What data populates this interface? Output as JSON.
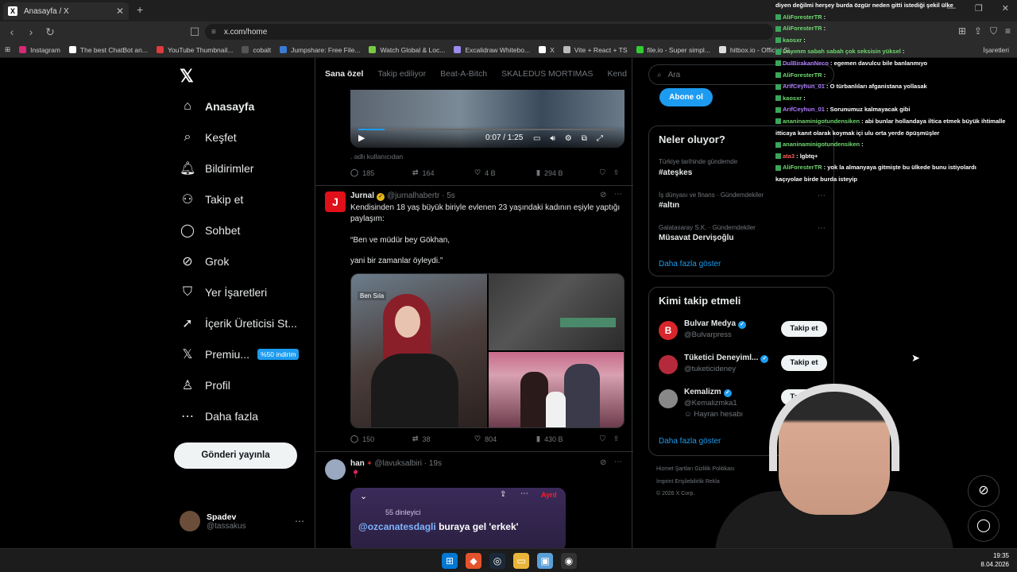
{
  "browser": {
    "tab_title": "Anasayfa / X",
    "url": "x.com/home",
    "bookmarks": [
      "Instagram",
      "The best ChatBot an...",
      "YouTube Thumbnail...",
      "cobalt",
      "Jumpshare: Free File...",
      "Watch Global & Loc...",
      "Excalidraw Whitebo...",
      "X",
      "Vite + React + TS",
      "file.io - Super simpl...",
      "hitbox.io - Official Si..."
    ],
    "bookmarks_more": "İşaretleri"
  },
  "sidebar": {
    "items": [
      {
        "label": "Anasayfa"
      },
      {
        "label": "Keşfet"
      },
      {
        "label": "Bildirimler"
      },
      {
        "label": "Takip et"
      },
      {
        "label": "Sohbet"
      },
      {
        "label": "Grok"
      },
      {
        "label": "Yer İşaretleri"
      },
      {
        "label": "İçerik Üreticisi St..."
      },
      {
        "label": "Premiu..."
      },
      {
        "label": "Profil"
      },
      {
        "label": "Daha fazla"
      }
    ],
    "premium_badge": "%50 indirim",
    "post_button": "Gönderi yayınla",
    "profile_name": "Spadev",
    "profile_handle": "@tassakus"
  },
  "feed": {
    "tabs": [
      "Sana özel",
      "Takip ediliyor",
      "Beat-A-Bitch",
      "SKALEDUS MORTIMAS",
      "Kend"
    ],
    "video": {
      "time": "0:07 / 1:25",
      "progress": 0.1
    },
    "post0": {
      "caption": ". adlı kullanıcıdan",
      "replies": "185",
      "reposts": "164",
      "likes": "4 B",
      "views": "294 B"
    },
    "post1": {
      "name": "Jurnal",
      "handle": "@jurnalhabertr · 5s",
      "text1": "Kendisinden 18 yaş büyük biriyle evlenen 23 yaşındaki kadının eşiyle yaptığı paylaşım:",
      "text2": "“Ben ve müdür bey Gökhan,",
      "text3": "yani bir zamanlar öyleydi.”",
      "image_caption": "Ben Sıla",
      "replies": "150",
      "reposts": "38",
      "likes": "804",
      "views": "430 B"
    },
    "post2": {
      "name": "han",
      "handle": "@lavuksalbiri · 19s",
      "space_listeners": "55 dinleyici",
      "space_tag": "@ozcanatesdagli",
      "space_text": "buraya gel 'erkek'",
      "space_leave": "Ayrıl"
    }
  },
  "right": {
    "search_placeholder": "Ara",
    "subscribe": "Abone ol",
    "trends_title": "Neler oluyor?",
    "trends": [
      {
        "category": "Türkiye tarihinde gündemde",
        "name": "#ateşkes"
      },
      {
        "category": "İş dünyası ve finans · Gündemdekiler",
        "name": "#altın"
      },
      {
        "category": "Galatasaray S.K. · Gündemdekiler",
        "name": "Müsavat Dervişoğlu"
      }
    ],
    "show_more": "Daha fazla göster",
    "follow_title": "Kimi takip etmeli",
    "follow": [
      {
        "name": "Bulvar Medya",
        "handle": "@Bulvarpress",
        "button": "Takip et"
      },
      {
        "name": "Tüketici Deneyiml...",
        "handle": "@tuketicideney",
        "button": "Takip et"
      },
      {
        "name": "Kemalizm",
        "handle": "@Kemalizmka1",
        "extra": "Hayran hesabı",
        "button": "Takip et"
      }
    ],
    "footer1": "Hizmet Şartları   Gizlilik Politikası",
    "footer2": "İmprint   Erişilebilirlik   Rekla",
    "footer3": "© 2026 X Corp."
  },
  "chat": [
    {
      "user": "",
      "text": "diyen değilmi herşey burda özgür neden gitti istediği şekil ülke"
    },
    {
      "user": "AliForesterTR",
      "text": ""
    },
    {
      "user": "AliForesterTR",
      "text": ""
    },
    {
      "user": "kaosxr",
      "text": ""
    },
    {
      "user": "Dayımm sabah sabah çok seksisin yüksel",
      "text": ""
    },
    {
      "user": "DulBirakanNeco",
      "text": "egemen davulcu bile banlanmıyo"
    },
    {
      "user": "AliForesterTR",
      "text": ""
    },
    {
      "user": "ArifCeyhun_01",
      "text": "O türbanlıları afganistana yollasak"
    },
    {
      "user": "kaosxr",
      "text": ""
    },
    {
      "user": "ArifCeyhun_01",
      "text": "Sorunumuz kalmayacak gibi"
    },
    {
      "user": "ananinaminigotundensiken",
      "text": "abi bunlar hollandaya iltica etmek büyük ihtimalle"
    },
    {
      "user": "",
      "text": "itticaya kanıt olarak koymak içi ulu orta yerde öpüşmüşler"
    },
    {
      "user": "ananinaminigotundensiken",
      "text": ""
    },
    {
      "user": "ata3",
      "text": "lgbtq+"
    },
    {
      "user": "AliForesterTR",
      "text": "yok la almanyaya gitmişte bu ülkede bunu istiyolardı"
    },
    {
      "user": "",
      "text": "kaçıyolae birde burda isteyip"
    }
  ],
  "taskbar": {
    "time": "19:35",
    "date": "8.04.2026"
  },
  "colors": {
    "accent": "#1d9bf0",
    "bg": "#000000",
    "border": "#2f3336"
  }
}
